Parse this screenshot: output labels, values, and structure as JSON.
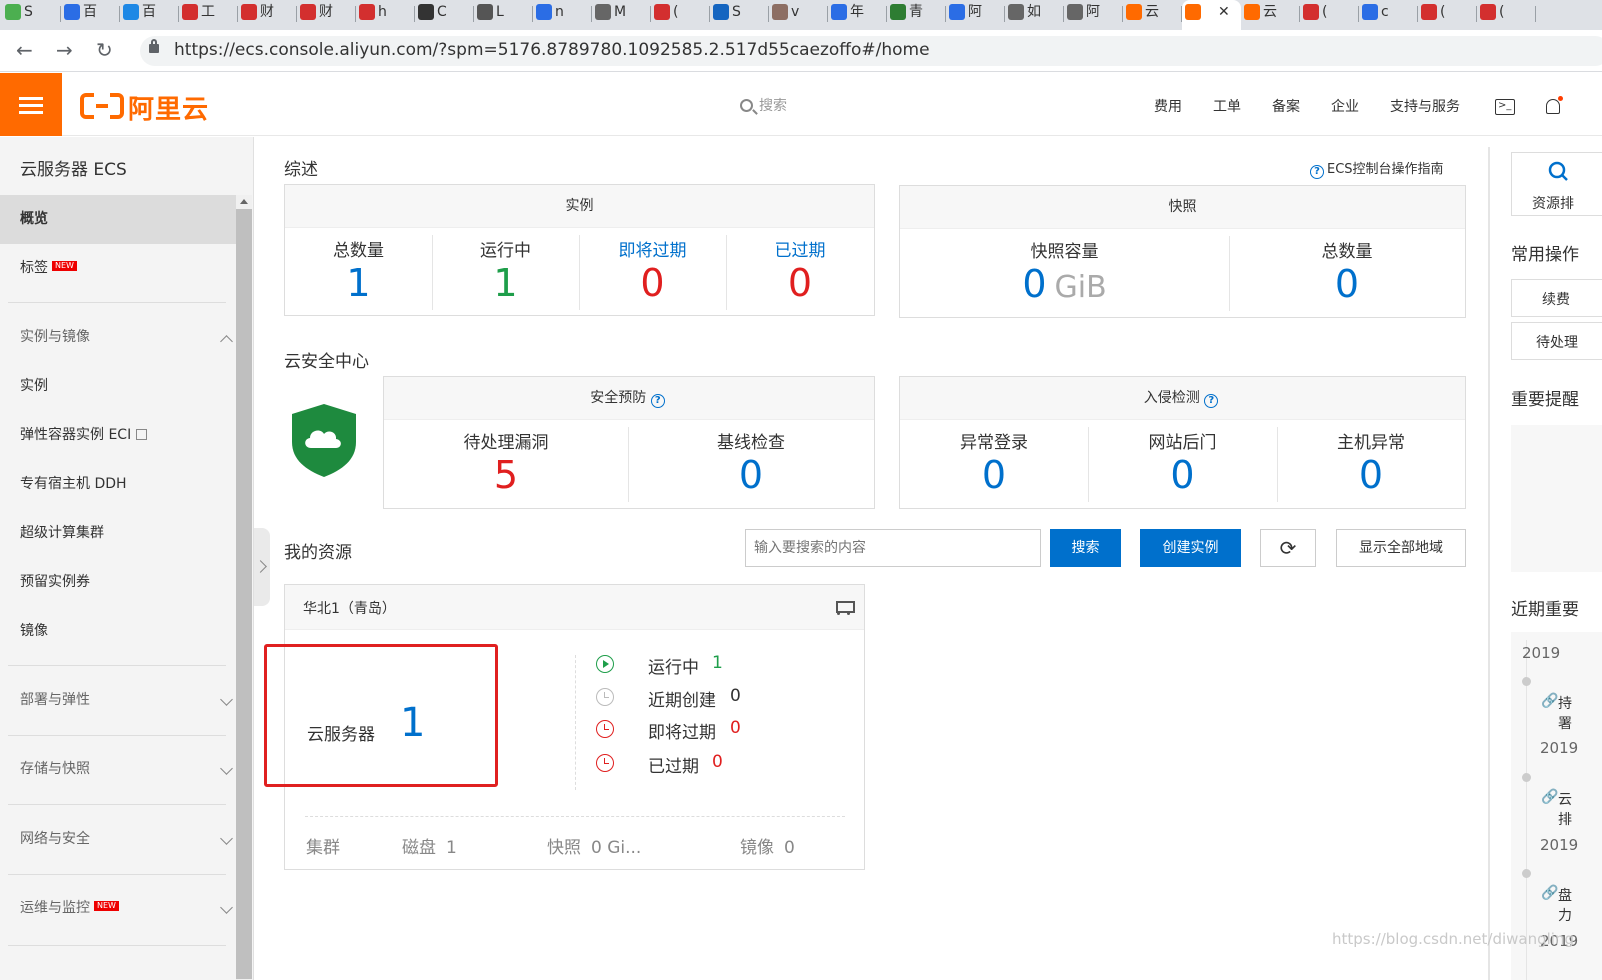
{
  "browser": {
    "tabs": [
      {
        "label": "S",
        "fav": "#4caf50"
      },
      {
        "label": "百",
        "fav": "#2b6de5"
      },
      {
        "label": "百",
        "fav": "#1e88e5"
      },
      {
        "label": "工",
        "fav": "#d32f2f"
      },
      {
        "label": "财",
        "fav": "#d32f2f"
      },
      {
        "label": "财",
        "fav": "#d32f2f"
      },
      {
        "label": "h",
        "fav": "#d32f2f"
      },
      {
        "label": "C",
        "fav": "#333333"
      },
      {
        "label": "L",
        "fav": "#555555"
      },
      {
        "label": "n",
        "fav": "#2b6de5"
      },
      {
        "label": "M",
        "fav": "#666666"
      },
      {
        "label": "(",
        "fav": "#d32f2f"
      },
      {
        "label": "S",
        "fav": "#1565c0"
      },
      {
        "label": "v",
        "fav": "#8d6e63"
      },
      {
        "label": "年",
        "fav": "#2b6de5"
      },
      {
        "label": "青",
        "fav": "#2e7d32"
      },
      {
        "label": "阿",
        "fav": "#2b6de5"
      },
      {
        "label": "如",
        "fav": "#666666"
      },
      {
        "label": "阿",
        "fav": "#666666"
      },
      {
        "label": "云",
        "fav": "#ff6a00"
      },
      {
        "label": "",
        "fav": "#ff6a00",
        "active": true,
        "close": "✕"
      },
      {
        "label": "云",
        "fav": "#ff6a00"
      },
      {
        "label": "(",
        "fav": "#d32f2f"
      },
      {
        "label": "c",
        "fav": "#2b6de5"
      },
      {
        "label": "(",
        "fav": "#d32f2f"
      },
      {
        "label": "(",
        "fav": "#d32f2f"
      }
    ],
    "back": "←",
    "forward": "→",
    "reload": "↻",
    "url": "https://ecs.console.aliyun.com/?spm=5176.8789780.1092585.2.517d55caezoffo#/home"
  },
  "topbar": {
    "brand": "阿里云",
    "search_placeholder": "搜索",
    "nav": [
      "费用",
      "工单",
      "备案",
      "企业",
      "支持与服务"
    ],
    "terminal_glyph": ">_"
  },
  "sidebar": {
    "title": "云服务器 ECS",
    "items": [
      {
        "label": "概览",
        "active": true
      },
      {
        "label": "标签",
        "badge": "NEW"
      },
      {
        "label": "实例与镜像",
        "group": true
      },
      {
        "label": "实例"
      },
      {
        "label": "弹性容器实例 ECI"
      },
      {
        "label": "专有宿主机 DDH"
      },
      {
        "label": "超级计算集群"
      },
      {
        "label": "预留实例券"
      },
      {
        "label": "镜像"
      },
      {
        "label": "部署与弹性",
        "group": true
      },
      {
        "label": "存储与快照",
        "group": true
      },
      {
        "label": "网络与安全",
        "group": true
      },
      {
        "label": "运维与监控",
        "group": true,
        "badge": "NEW"
      }
    ]
  },
  "overview": {
    "title": "综述",
    "guide_link": "ECS控制台操作指南",
    "instances": {
      "head": "实例",
      "stats": [
        {
          "label": "总数量",
          "value": "1"
        },
        {
          "label": "运行中",
          "value": "1"
        },
        {
          "label": "即将过期",
          "value": "0"
        },
        {
          "label": "已过期",
          "value": "0"
        }
      ]
    },
    "snapshots": {
      "head": "快照",
      "stats": [
        {
          "label": "快照容量",
          "value": "0",
          "unit": "GiB"
        },
        {
          "label": "总数量",
          "value": "0"
        }
      ]
    }
  },
  "security": {
    "title": "云安全中心",
    "prevention": {
      "head": "安全预防",
      "stats": [
        {
          "label": "待处理漏洞",
          "value": "5"
        },
        {
          "label": "基线检查",
          "value": "0"
        }
      ]
    },
    "intrusion": {
      "head": "入侵检测",
      "stats": [
        {
          "label": "异常登录",
          "value": "0"
        },
        {
          "label": "网站后门",
          "value": "0"
        },
        {
          "label": "主机异常",
          "value": "0"
        }
      ]
    }
  },
  "resources": {
    "title": "我的资源",
    "search_placeholder": "输入要搜索的内容",
    "search_btn": "搜索",
    "create_btn": "创建实例",
    "refresh_glyph": "⟳",
    "show_all_btn": "显示全部地域",
    "region": {
      "name": "华北1（青岛）",
      "ecs_label": "云服务器",
      "ecs_count": "1",
      "statuses": [
        {
          "label": "运行中",
          "value": "1"
        },
        {
          "label": "近期创建",
          "value": "0"
        },
        {
          "label": "即将过期",
          "value": "0"
        },
        {
          "label": "已过期",
          "value": "0"
        }
      ],
      "footer": [
        {
          "label": "集群",
          "value": ""
        },
        {
          "label": "磁盘",
          "value": "1"
        },
        {
          "label": "快照",
          "value": "0 Gi..."
        },
        {
          "label": "镜像",
          "value": "0"
        }
      ]
    }
  },
  "right_rail": {
    "resource_label": "资源排",
    "common_ops": "常用操作",
    "btn_renew": "续费",
    "btn_pending": "待处理",
    "important": "重要提醒",
    "recent": "近期重要",
    "years": [
      "2019",
      "2019",
      "2019",
      "2019"
    ],
    "notes": [
      "持",
      "署",
      "云",
      "排",
      "盘",
      "力"
    ]
  },
  "watermark": "https://blog.csdn.net/diwangling"
}
